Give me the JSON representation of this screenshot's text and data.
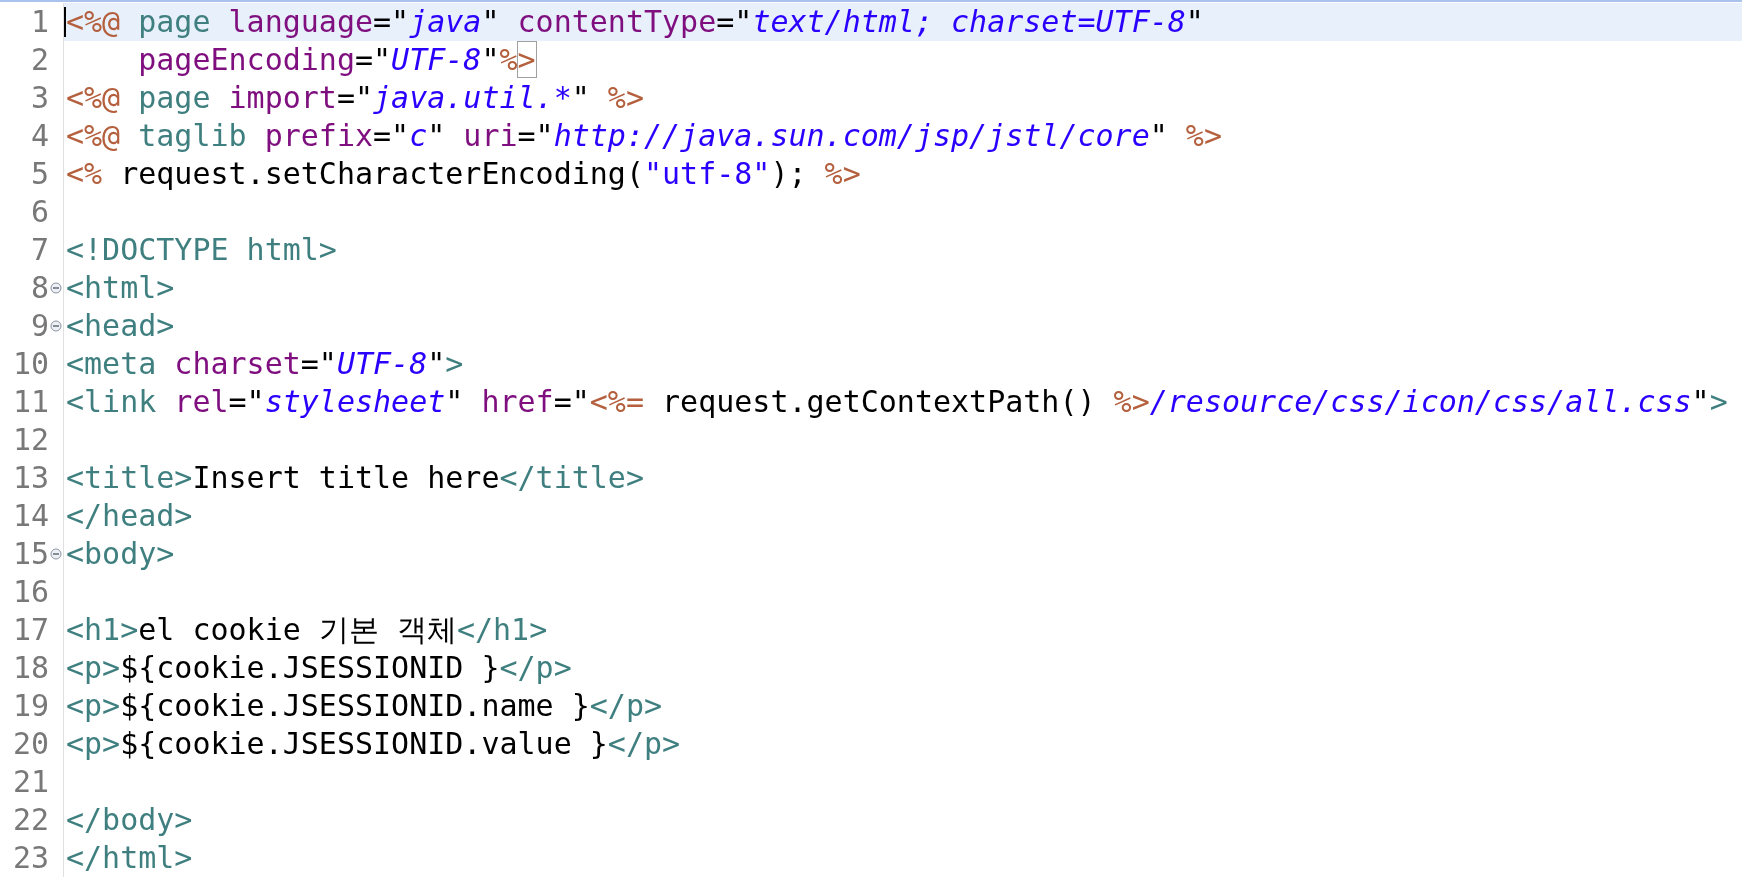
{
  "editor": {
    "lines": [
      {
        "number": "1",
        "current": true,
        "tokens": [
          {
            "kind": "jsp",
            "text": "<%@"
          },
          {
            "kind": "tag",
            "text": " page"
          },
          {
            "kind": "attr",
            "text": " language"
          },
          {
            "kind": "text",
            "text": "=\""
          },
          {
            "kind": "string",
            "text": "java"
          },
          {
            "kind": "text",
            "text": "\""
          },
          {
            "kind": "attr",
            "text": " contentType"
          },
          {
            "kind": "text",
            "text": "=\""
          },
          {
            "kind": "string",
            "text": "text/html; charset=UTF-8"
          },
          {
            "kind": "text",
            "text": "\""
          }
        ]
      },
      {
        "number": "2",
        "current": false,
        "tokens": [
          {
            "kind": "attr",
            "text": "    pageEncoding"
          },
          {
            "kind": "text",
            "text": "=\""
          },
          {
            "kind": "string",
            "text": "UTF-8"
          },
          {
            "kind": "text",
            "text": "\""
          },
          {
            "kind": "jsp",
            "text": "%"
          },
          {
            "kind": "jsp",
            "text": ">",
            "bracket_match": true
          }
        ]
      },
      {
        "number": "3",
        "current": false,
        "tokens": [
          {
            "kind": "jsp",
            "text": "<%@"
          },
          {
            "kind": "tag",
            "text": " page"
          },
          {
            "kind": "attr",
            "text": " import"
          },
          {
            "kind": "text",
            "text": "=\""
          },
          {
            "kind": "string",
            "text": "java.util.*"
          },
          {
            "kind": "text",
            "text": "\""
          },
          {
            "kind": "jsp",
            "text": " %>"
          }
        ]
      },
      {
        "number": "4",
        "current": false,
        "tokens": [
          {
            "kind": "jsp",
            "text": "<%@"
          },
          {
            "kind": "tag",
            "text": " taglib"
          },
          {
            "kind": "attr",
            "text": " prefix"
          },
          {
            "kind": "text",
            "text": "=\""
          },
          {
            "kind": "string",
            "text": "c"
          },
          {
            "kind": "text",
            "text": "\""
          },
          {
            "kind": "attr",
            "text": " uri"
          },
          {
            "kind": "text",
            "text": "=\""
          },
          {
            "kind": "string",
            "text": "http://java.sun.com/jsp/jstl/core"
          },
          {
            "kind": "text",
            "text": "\""
          },
          {
            "kind": "jsp",
            "text": " %>"
          }
        ]
      },
      {
        "number": "5",
        "current": false,
        "tokens": [
          {
            "kind": "jsp",
            "text": "<%"
          },
          {
            "kind": "text",
            "text": " request.setCharacterEncoding("
          },
          {
            "kind": "string_plain",
            "text": "\"utf-8\""
          },
          {
            "kind": "text",
            "text": ");"
          },
          {
            "kind": "jsp",
            "text": " %>"
          }
        ]
      },
      {
        "number": "6",
        "current": false
      },
      {
        "number": "7",
        "current": false,
        "tokens": [
          {
            "kind": "tag",
            "text": "<!DOCTYPE html>"
          }
        ]
      },
      {
        "number": "8",
        "current": false,
        "folded": false,
        "tokens": [
          {
            "kind": "tag",
            "text": "<html>"
          }
        ]
      },
      {
        "number": "9",
        "current": false,
        "folded": false,
        "tokens": [
          {
            "kind": "tag",
            "text": "<head>"
          }
        ]
      },
      {
        "number": "10",
        "current": false,
        "tokens": [
          {
            "kind": "tag",
            "text": "<meta"
          },
          {
            "kind": "attr",
            "text": " charset"
          },
          {
            "kind": "text",
            "text": "=\""
          },
          {
            "kind": "string",
            "text": "UTF-8"
          },
          {
            "kind": "text",
            "text": "\""
          },
          {
            "kind": "tag",
            "text": ">"
          }
        ]
      },
      {
        "number": "11",
        "current": false,
        "tokens": [
          {
            "kind": "tag",
            "text": "<link"
          },
          {
            "kind": "attr",
            "text": " rel"
          },
          {
            "kind": "text",
            "text": "=\""
          },
          {
            "kind": "string",
            "text": "stylesheet"
          },
          {
            "kind": "text",
            "text": "\""
          },
          {
            "kind": "attr",
            "text": " href"
          },
          {
            "kind": "text",
            "text": "=\""
          },
          {
            "kind": "jsp",
            "text": "<%="
          },
          {
            "kind": "text",
            "text": " request.getContextPath() "
          },
          {
            "kind": "jsp",
            "text": "%>"
          },
          {
            "kind": "string",
            "text": "/resource/css/icon/css/all.css"
          },
          {
            "kind": "text",
            "text": "\""
          },
          {
            "kind": "tag",
            "text": ">"
          }
        ]
      },
      {
        "number": "12",
        "current": false
      },
      {
        "number": "13",
        "current": false,
        "tokens": [
          {
            "kind": "tag",
            "text": "<title>"
          },
          {
            "kind": "text",
            "text": "Insert title here"
          },
          {
            "kind": "tag",
            "text": "</title>"
          }
        ]
      },
      {
        "number": "14",
        "current": false,
        "tokens": [
          {
            "kind": "tag",
            "text": "</head>"
          }
        ]
      },
      {
        "number": "15",
        "current": false,
        "folded": false,
        "tokens": [
          {
            "kind": "tag",
            "text": "<body>"
          }
        ]
      },
      {
        "number": "16",
        "current": false
      },
      {
        "number": "17",
        "current": false,
        "tokens": [
          {
            "kind": "tag",
            "text": "<h1>"
          },
          {
            "kind": "text",
            "text": "el cookie 기본 객체"
          },
          {
            "kind": "tag",
            "text": "</h1>"
          }
        ]
      },
      {
        "number": "18",
        "current": false,
        "tokens": [
          {
            "kind": "tag",
            "text": "<p>"
          },
          {
            "kind": "text",
            "text": "${cookie.JSESSIONID }"
          },
          {
            "kind": "tag",
            "text": "</p>"
          }
        ]
      },
      {
        "number": "19",
        "current": false,
        "tokens": [
          {
            "kind": "tag",
            "text": "<p>"
          },
          {
            "kind": "text",
            "text": "${cookie.JSESSIONID.name }"
          },
          {
            "kind": "tag",
            "text": "</p>"
          }
        ]
      },
      {
        "number": "20",
        "current": false,
        "tokens": [
          {
            "kind": "tag",
            "text": "<p>"
          },
          {
            "kind": "text",
            "text": "${cookie.JSESSIONID.value }"
          },
          {
            "kind": "tag",
            "text": "</p>"
          }
        ]
      },
      {
        "number": "21",
        "current": false
      },
      {
        "number": "22",
        "current": false,
        "tokens": [
          {
            "kind": "tag",
            "text": "</body>"
          }
        ]
      },
      {
        "number": "23",
        "current": false,
        "tokens": [
          {
            "kind": "tag",
            "text": "</html>"
          }
        ]
      }
    ]
  }
}
